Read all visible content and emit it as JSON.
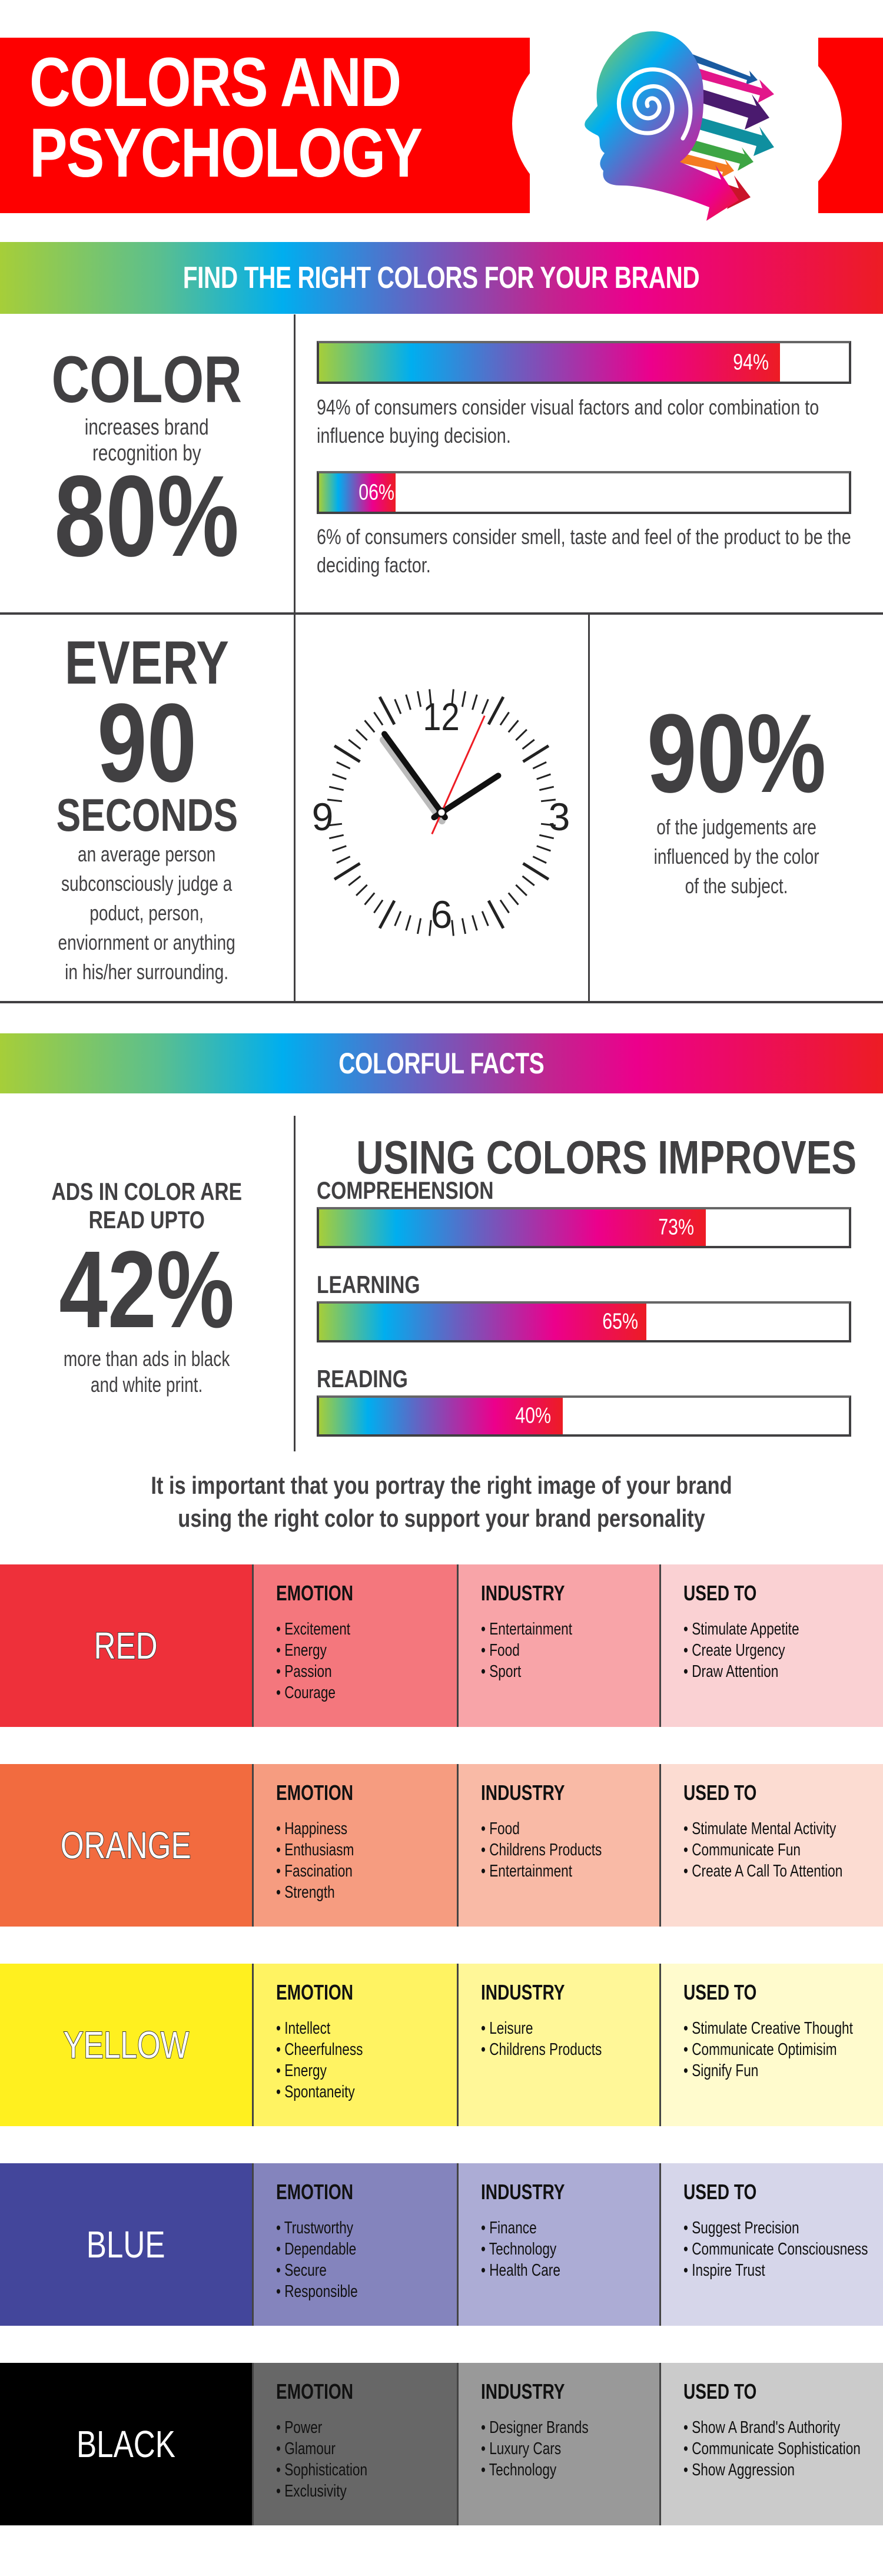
{
  "header": {
    "title_line1": "COLORS AND",
    "title_line2": "PSYCHOLOGY",
    "illustration": "head-spiral-arrows-icon"
  },
  "section1": {
    "banner": "FIND THE RIGHT COLORS FOR YOUR BRAND",
    "color_stat": {
      "headline": "COLOR",
      "subtext_line1": "increases brand",
      "subtext_line2": "recognition by",
      "value": "80%"
    },
    "bars": [
      {
        "label": "94%",
        "value": 94,
        "description": "94% of consumers consider visual factors and color combination to influence buying decision."
      },
      {
        "label": "06%",
        "value": 6,
        "description": "6% of consumers consider smell, taste and feel of the product to be the deciding factor."
      }
    ],
    "every_stat": {
      "line1": "EVERY",
      "line2": "90",
      "line3": "SECONDS",
      "body": [
        "an average person",
        "subconsciously judge a",
        "poduct, person,",
        "enviornment or anything",
        "in his/her surrounding."
      ]
    },
    "clock": {
      "numerals": [
        "12",
        "3",
        "6",
        "9"
      ],
      "time_hours": 1,
      "time_minutes": 54,
      "time_seconds": 34
    },
    "judgement_stat": {
      "value": "90%",
      "body": [
        "of the judgements are",
        "influenced by the color",
        "of the subject."
      ]
    }
  },
  "section2": {
    "banner": "COLORFUL FACTS",
    "ads_stat": {
      "line1": "ADS IN COLOR ARE",
      "line2": "READ UPTO",
      "value": "42%",
      "body_line1": "more than ads in black",
      "body_line2": "and white print."
    },
    "improves_title": "USING COLORS IMPROVES",
    "bars": [
      {
        "title": "COMPREHENSION",
        "label": "73%",
        "value": 73
      },
      {
        "title": "LEARNING",
        "label": "65%",
        "value": 65
      },
      {
        "title": "READING",
        "label": "40%",
        "value": 40
      }
    ]
  },
  "tagline": {
    "line1": "It is important that you portray the right image of your brand",
    "line2": "using the right color to support your brand personality"
  },
  "column_headers": {
    "emotion": "EMOTION",
    "industry": "INDUSTRY",
    "used_to": "USED TO"
  },
  "colors": [
    {
      "name": "RED",
      "swatch": [
        "#ee303a",
        "#f4777d",
        "#f8a4a8",
        "#fad1d3"
      ],
      "emotion": [
        "Excitement",
        "Energy",
        "Passion",
        "Courage"
      ],
      "industry": [
        "Entertainment",
        "Food",
        "Sport"
      ],
      "used_to": [
        "Stimulate Appetite",
        "Create Urgency",
        "Draw Attention"
      ]
    },
    {
      "name": "ORANGE",
      "swatch": [
        "#f26b3f",
        "#f69c80",
        "#f9baa6",
        "#fcdcd2"
      ],
      "emotion": [
        "Happiness",
        "Enthusiasm",
        "Fascination",
        "Strength"
      ],
      "industry": [
        "Food",
        "Childrens Products",
        "Entertainment"
      ],
      "used_to": [
        "Stimulate Mental Activity",
        "Communicate Fun",
        "Create A Call To Attention"
      ]
    },
    {
      "name": "YELLOW",
      "swatch": [
        "#fff01f",
        "#fff362",
        "#fff798",
        "#fffbcd"
      ],
      "emotion": [
        "Intellect",
        "Cheerfulness",
        "Energy",
        "Spontaneity"
      ],
      "industry": [
        "Leisure",
        "Childrens Products"
      ],
      "used_to": [
        "Stimulate Creative Thought",
        "Communicate Optimisim",
        "Signify Fun"
      ]
    },
    {
      "name": "BLUE",
      "swatch": [
        "#43469b",
        "#8484bd",
        "#acacd5",
        "#d6d6ea"
      ],
      "emotion": [
        "Trustworthy",
        "Dependable",
        "Secure",
        "Responsible"
      ],
      "industry": [
        "Finance",
        "Technology",
        "Health Care"
      ],
      "used_to": [
        "Suggest Precision",
        "Communicate Consciousness",
        "Inspire Trust"
      ]
    },
    {
      "name": "BLACK",
      "swatch": [
        "#000000",
        "#676767",
        "#999999",
        "#cbcbcb"
      ],
      "emotion": [
        "Power",
        "Glamour",
        "Sophistication",
        "Exclusivity"
      ],
      "industry": [
        "Designer Brands",
        "Luxury Cars",
        "Technology"
      ],
      "used_to": [
        "Show A Brand's Authority",
        "Communicate Sophistication",
        "Show Aggression"
      ]
    }
  ]
}
